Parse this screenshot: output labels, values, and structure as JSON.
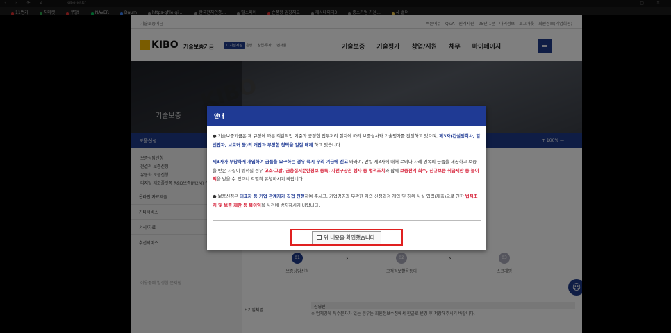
{
  "browser": {
    "url": "kibo.or.kr",
    "bookmarks": [
      {
        "label": "11번가",
        "color": "#e03030"
      },
      {
        "label": "지마켓",
        "color": "#2fa84f"
      },
      {
        "label": "쿠팡!",
        "color": "#e03030"
      },
      {
        "label": "NAVER",
        "color": "#03c75a"
      },
      {
        "label": "Daum",
        "color": "#3b82f6"
      },
      {
        "label": "https-gfile.gil...",
        "color": "#888888"
      },
      {
        "label": "한국전자인증...",
        "color": "#888888"
      },
      {
        "label": "빌스페어",
        "color": "#888888"
      },
      {
        "label": "손품왕 임장지도",
        "color": "#e03030"
      },
      {
        "label": "캐시데이터3",
        "color": "#888888"
      },
      {
        "label": "중소기업 가윤...",
        "color": "#888888"
      },
      {
        "label": "새 폴더",
        "color": "#f2c94c"
      }
    ]
  },
  "site": {
    "home_label": "기술보증기금",
    "utility_links": [
      "빠른메뉴",
      "Q&A",
      "원격지원",
      "25년 1분",
      "나의정보",
      "로그아웃",
      "회원정보(기업회원)"
    ],
    "logo_text": "KIBO",
    "org_name": "기술보증기금",
    "digital_badge": "디지털지점",
    "sub_nav": [
      "은행",
      "창업·투자",
      "벤처원"
    ],
    "main_nav": [
      "기술보증",
      "기술평가",
      "창업/지원",
      "채무",
      "마이페이지"
    ],
    "menu_icon": "hamburger-icon",
    "banner_title": "기술보증",
    "lnb_title": "보증신청",
    "zoom_label": "+ 100% —",
    "lnb_subitems": [
      "보증상담신청",
      "전결적 보증신청",
      "유동화 보증신청",
      "디지털 제조플랫폼 R&D보증(M2M) 신청"
    ],
    "lnb_groups": [
      "온라인 자료제출",
      "기타서비스",
      "서식/자료",
      "추천서비스"
    ],
    "lnb_footer": "이용중에 발생한 문제점 ...."
  },
  "steps": [
    {
      "num": "01",
      "label": "보증상담신청",
      "active": true
    },
    {
      "num": "02",
      "label": "고객정보활용동의",
      "active": false
    },
    {
      "num": "03",
      "label": "스크래핑",
      "active": false
    }
  ],
  "form": {
    "label": "* 기업체명",
    "value": "신영진",
    "note": "※ 업체명에 특수문자가 있는 경우는 회원정보수정에서 한글로 변경 후 저장해주시기 바랍니다."
  },
  "modal": {
    "title": "안내",
    "p1_a": "● 기술보증기금은 제 규정에 따른 객관적인 기준과 공정한 업무처리 절차에 따라 보증심사와 기술평가를 진행하고 있으며, ",
    "p1_b": "제3자(컨설팅회사, 알선업자, 브로커 등)의 개입과 부정한 청탁을 일절 배제",
    "p1_c": " 하고 있습니다.",
    "p2_a": "제3자가 부당하게 개입하여 금품을 요구하는 경우 즉시 우리 기금에 신고",
    "p2_b": " 바라며, 만일 제3자에 대해 로비나 사례 명목의 금품을 제공하고 보증을 받은 사실이 밝혀질 경우 ",
    "p2_c": "고소·고발, 금융질서문란정보 등록, 사전구상권 행사 등 법적조치",
    "p2_d": "와 함께 ",
    "p2_e": "보증전액 회수, 신규보증 취급제한 등 불이익",
    "p2_f": "을 받을 수 있으니 각별히 유념하시기 바랍니다.",
    "p3_a": "● 보증신청은 ",
    "p3_b": "대표자 등 기업 관계자가 직접 진행",
    "p3_c": "하여 주시고, 기업경영과 무관한 자의 신청과정 개입 및 허위 사실 입력(제출)으로 인한 ",
    "p3_d": "법적조치 및 보증 제한 등 불이익",
    "p3_e": "을 사전에 방지하시기 바랍니다.",
    "confirm_label": "위 내용을 확인했습니다."
  },
  "colors": {
    "primary": "#1f3a94",
    "highlight_border": "#e02020",
    "warning": "#d7263d"
  }
}
